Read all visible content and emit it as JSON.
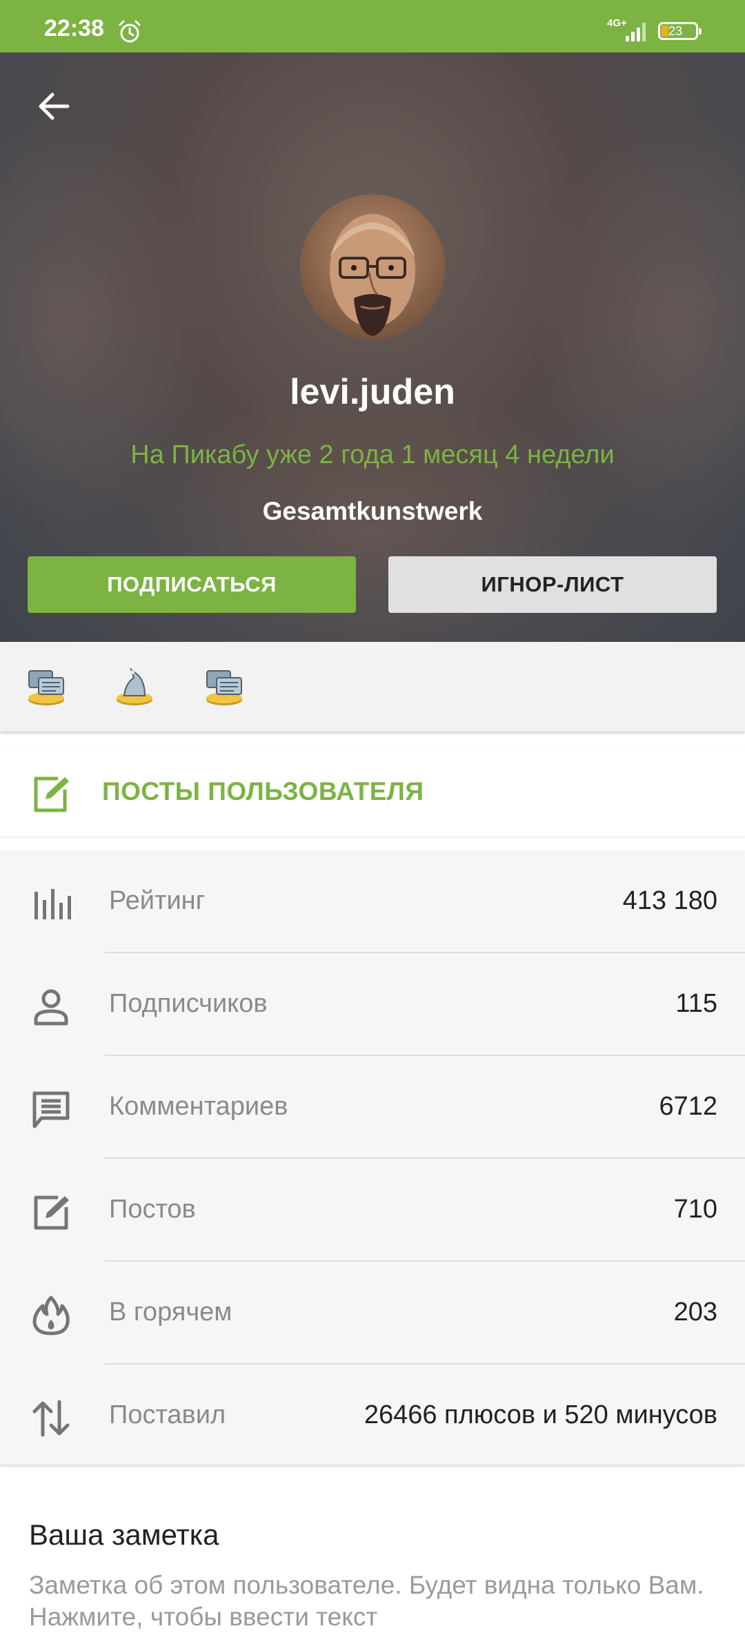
{
  "status_bar": {
    "time": "22:38",
    "network": "4G+",
    "battery": "23",
    "icons": [
      "alarm-icon",
      "signal-icon",
      "battery-icon"
    ]
  },
  "profile": {
    "username": "levi.juden",
    "tenure": "На Пикабу уже 2 года 1 месяц 4 недели",
    "status": "Gesamtkunstwerk",
    "subscribe_label": "ПОДПИСАТЬСЯ",
    "ignore_label": "ИГНОР-ЛИСТ",
    "awards": [
      "comments-award-icon",
      "posts-award-icon",
      "comments-award-icon"
    ]
  },
  "posts_link": {
    "label": "ПОСТЫ ПОЛЬЗОВАТЕЛЯ",
    "icon": "edit-icon"
  },
  "stats": [
    {
      "label": "Рейтинг",
      "value": "413 180",
      "icon": "rating-icon"
    },
    {
      "label": "Подписчиков",
      "value": "115",
      "icon": "person-icon"
    },
    {
      "label": "Комментариев",
      "value": "6712",
      "icon": "comment-icon"
    },
    {
      "label": "Постов",
      "value": "710",
      "icon": "edit-icon"
    },
    {
      "label": "В горячем",
      "value": "203",
      "icon": "flame-icon"
    },
    {
      "label": "Поставил",
      "value": "26466 плюсов и 520 минусов",
      "icon": "sort-arrows-icon"
    }
  ],
  "note": {
    "title": "Ваша заметка",
    "hint": "Заметка об этом пользователе. Будет видна только Вам. Нажмите, чтобы ввести текст"
  },
  "colors": {
    "accent": "#7cb342",
    "hero_bg": "#4e4a4c",
    "stats_bg": "#f6f6f6"
  }
}
